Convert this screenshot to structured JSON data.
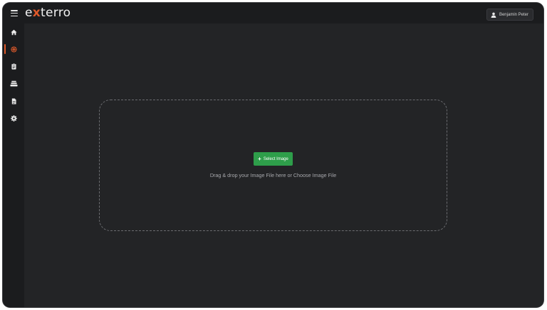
{
  "header": {
    "logo": {
      "pre": "e",
      "x": "x",
      "post": "terro"
    },
    "user_name": "Benjamin Peter",
    "icons": {
      "menu": "hamburger-menu-icon",
      "user": "user-icon"
    }
  },
  "sidebar": {
    "items": [
      {
        "name": "home",
        "icon": "home-icon",
        "active": false
      },
      {
        "name": "dashboard",
        "icon": "target-grid-icon",
        "active": true
      },
      {
        "name": "reports",
        "icon": "clipboard-icon",
        "active": false
      },
      {
        "name": "storage",
        "icon": "stack-icon",
        "active": false
      },
      {
        "name": "documents",
        "icon": "document-icon",
        "active": false
      },
      {
        "name": "settings",
        "icon": "gear-icon",
        "active": false
      }
    ]
  },
  "upload": {
    "button_label": "Select Image",
    "button_icon": "plus-icon",
    "hint": "Drag & drop your Image File here or Choose Image File"
  },
  "colors": {
    "accent": "#e05a2b",
    "button": "#2e9e4a",
    "background": "#232426"
  }
}
